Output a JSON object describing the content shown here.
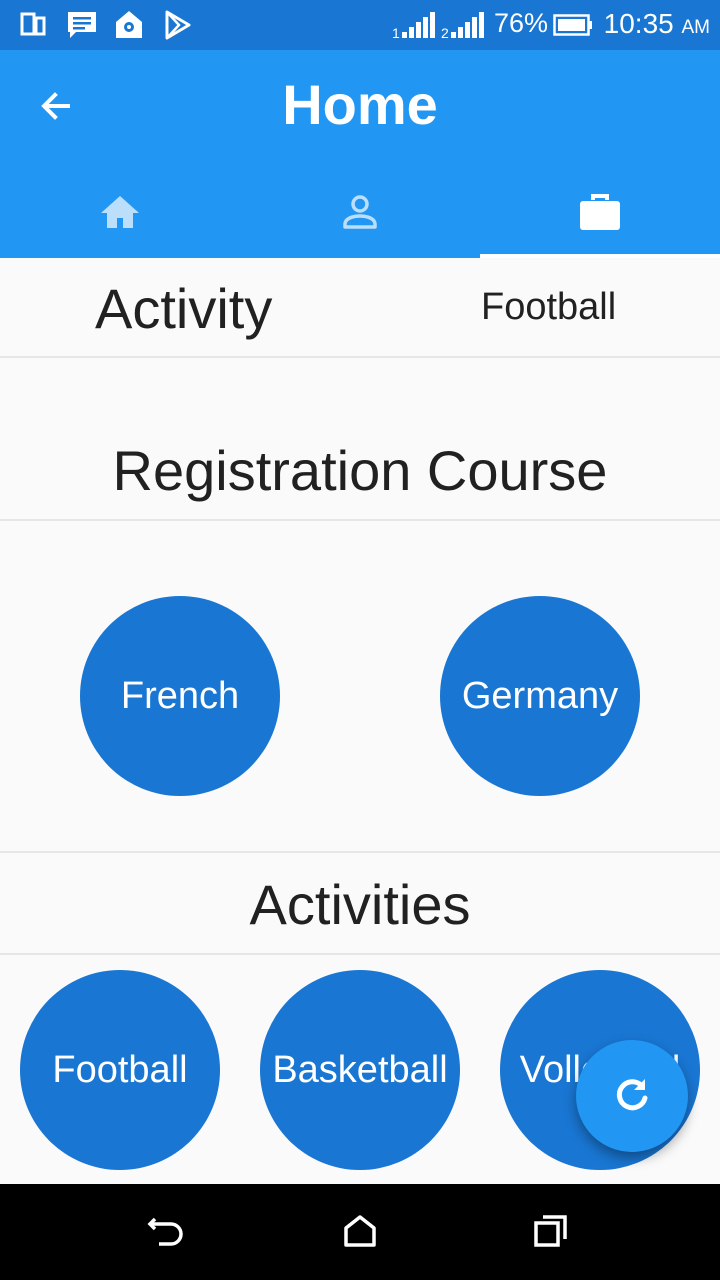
{
  "status_bar": {
    "battery": "76%",
    "time": "10:35",
    "ampm": "AM",
    "icons": [
      "phone-icon",
      "message-icon",
      "location-icon",
      "play-store-icon",
      "signal-1-icon",
      "signal-2-icon",
      "battery-icon"
    ]
  },
  "app_bar": {
    "title": "Home",
    "back_icon": "arrow-back-icon",
    "tabs": [
      {
        "icon": "home-icon",
        "active": false
      },
      {
        "icon": "person-icon",
        "active": false
      },
      {
        "icon": "briefcase-icon",
        "active": true
      }
    ]
  },
  "activity_row": {
    "label": "Activity",
    "value": "Football"
  },
  "registration": {
    "title": "Registration Course",
    "courses": [
      "French",
      "Germany"
    ]
  },
  "activities": {
    "title": "Activities",
    "items": [
      "Football",
      "Basketball",
      "Volleyball"
    ]
  },
  "fab": {
    "icon": "refresh-icon"
  },
  "nav_bar": {
    "icons": [
      "back-icon",
      "home-nav-icon",
      "recents-icon"
    ]
  },
  "colors": {
    "status_bar": "#1976d2",
    "app_bar": "#2196f3",
    "circle": "#1976d2",
    "fab": "#2196f3",
    "background": "#fafafa"
  }
}
